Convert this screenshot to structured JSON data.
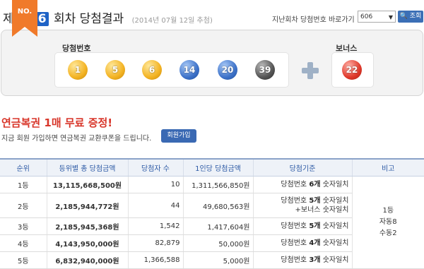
{
  "header": {
    "prefix": "제",
    "round": "606",
    "suffix": "회차 당첨결과",
    "draw_date": "(2014년 07월 12일 추첨)",
    "prev_label": "지난회차 당첨번호 바로가기",
    "select_value": "606",
    "search_label": "조회"
  },
  "result": {
    "badge": "NO.",
    "win_label": "당첨번호",
    "bonus_label": "보너스",
    "numbers": [
      "1",
      "5",
      "6",
      "14",
      "20",
      "39"
    ],
    "bonus": "22",
    "colors": {
      "yellow": "#f3b323",
      "blue": "#3d72c9",
      "gray": "#555555",
      "red": "#e0392b",
      "ribbon": "#f07a2a"
    }
  },
  "promo": {
    "title": "연금복권 1매 무료 증정!",
    "desc": "지금 회원 가입하면 연금복권 교환쿠폰을 드립니다.",
    "join_label": "회원가입"
  },
  "table": {
    "headers": [
      "순위",
      "등위별 총 당첨금액",
      "당첨자 수",
      "1인당 당첨금액",
      "당첨기준",
      "비고"
    ],
    "rows": [
      {
        "rank": "1등",
        "total": "13,115,668,500원",
        "winners": "10",
        "per": "1,311,566,850원",
        "crit_pre": "당첨번호",
        "crit_bold": "6개",
        "crit_post": "숫자일치",
        "crit_line2": ""
      },
      {
        "rank": "2등",
        "total": "2,185,944,772원",
        "winners": "44",
        "per": "49,680,563원",
        "crit_pre": "당첨번호",
        "crit_bold": "5개",
        "crit_post": "숫자일치",
        "crit_line2": "+보너스 숫자일치"
      },
      {
        "rank": "3등",
        "total": "2,185,945,368원",
        "winners": "1,542",
        "per": "1,417,604원",
        "crit_pre": "당첨번호",
        "crit_bold": "5개",
        "crit_post": "숫자일치",
        "crit_line2": ""
      },
      {
        "rank": "4등",
        "total": "4,143,950,000원",
        "winners": "82,879",
        "per": "50,000원",
        "crit_pre": "당첨번호",
        "crit_bold": "4개",
        "crit_post": "숫자일치",
        "crit_line2": ""
      },
      {
        "rank": "5등",
        "total": "6,832,940,000원",
        "winners": "1,366,588",
        "per": "5,000원",
        "crit_pre": "당첨번호",
        "crit_bold": "3개",
        "crit_post": "숫자일치",
        "crit_line2": ""
      }
    ],
    "note": [
      "1등",
      "자동8",
      "수동2"
    ]
  }
}
